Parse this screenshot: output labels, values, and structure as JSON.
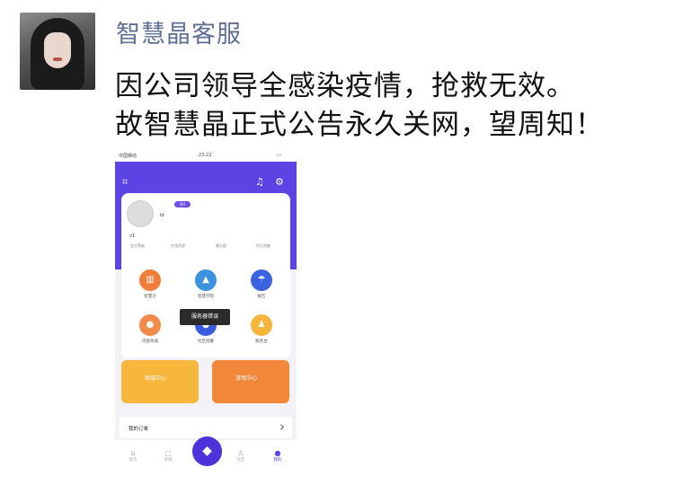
{
  "sender_name": "智慧晶客服",
  "messages": [
    "因公司领导全感染疫情，抢救无效。",
    "故智慧晶正式公告永久关网，望周知！"
  ],
  "phone": {
    "status_carrier": "中国移动",
    "status_time": "23:22",
    "vip_badge": "DH",
    "profile_name": "id",
    "profile_id": "v1",
    "stats": [
      "会员等级",
      "在线资源",
      "算力值",
      "积分余额"
    ],
    "menu_items": [
      {
        "label": "智慧仓",
        "icon": "chart-icon",
        "color": "#f07d3a"
      },
      {
        "label": "智慧学院",
        "icon": "graduation-icon",
        "color": "#3b93e0"
      },
      {
        "label": "报告",
        "icon": "umbrella-icon",
        "color": "#3b63e0"
      },
      {
        "label": "内部商城",
        "icon": "chat-icon",
        "color": "#f28a4a"
      },
      {
        "label": "社区招募",
        "icon": "group-icon",
        "color": "#3b5be0"
      },
      {
        "label": "服务台",
        "icon": "person-icon",
        "color": "#f5b53a"
      }
    ],
    "toast": "服务器错误",
    "banners": [
      "商城中心",
      "游戏中心"
    ],
    "orders_label": "我的订单",
    "tabs": [
      "首页",
      "商城",
      "",
      "社区",
      "我的"
    ]
  }
}
